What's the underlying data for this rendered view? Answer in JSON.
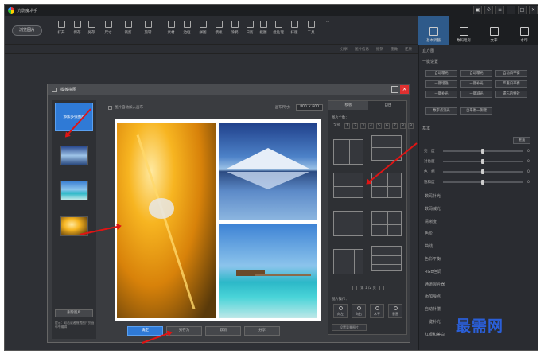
{
  "app": {
    "name": "光影魔术手"
  },
  "window_controls": [
    "▣",
    "ꖴ",
    "≡",
    "–",
    "□",
    "✕"
  ],
  "toolbar": {
    "open": "浏览图片",
    "tools": [
      "打开",
      "保存",
      "另存",
      "尺寸",
      "裁剪",
      "旋转",
      "素材",
      "边框",
      "拼图",
      "模板",
      "涂鸦",
      "日历",
      "抠图",
      "批处理",
      "排版",
      "工具",
      "···"
    ]
  },
  "right_tabs": [
    "基本调整",
    "数码暗房",
    "文字",
    "水印"
  ],
  "subbar": [
    "分享",
    "图片信息",
    "撤销",
    "重做",
    "还原"
  ],
  "right_panel": {
    "histogram": "直方图",
    "one_click": "一键设置",
    "buttons": [
      "自动曝光",
      "自动曝光",
      "自动白平衡",
      "一键增艳",
      "一键补光",
      "严重白平衡",
      "一键补光",
      "一键减光",
      "遗忘的特效",
      "数字点测光",
      "自平衡一侧键"
    ],
    "basic": "基本",
    "reset": "重置",
    "sliders": [
      {
        "label": "亮　度",
        "value": "0",
        "pos": 0.5
      },
      {
        "label": "对比度",
        "value": "0",
        "pos": 0.5
      },
      {
        "label": "色　相",
        "value": "0",
        "pos": 0.5
      },
      {
        "label": "饱和度",
        "value": "0",
        "pos": 0.5
      }
    ],
    "sections": [
      "数码补光",
      "数码减光",
      "清晰度",
      "色阶",
      "曲线",
      "色彩平衡",
      "RGB色调",
      "通道混合器",
      "添加噪点",
      "自动补偿",
      "一键补光",
      "红眼和美白"
    ]
  },
  "dialog": {
    "title": "模板拼图",
    "add_multi": "添加多张图片",
    "auto_add": "图片自动加入画布",
    "size_label": "画布尺寸：",
    "size_value": "800 × 600",
    "delete": "删除图片",
    "tip": "提示：双击或者拖拽图片到画布中编辑",
    "tabs": [
      "模板",
      "自由"
    ],
    "pic_count": "图片个数：",
    "counts": [
      "全部",
      "1",
      "2",
      "3",
      "4",
      "5",
      "6",
      "7",
      "8",
      "9"
    ],
    "pager": "第 1 /2 页",
    "ops": "图片操作：",
    "op_buttons": [
      "向左",
      "向右",
      "水平",
      "垂直"
    ],
    "set_bg": "设置背景图片",
    "footer": [
      "确定",
      "另存为",
      "取消",
      "分享"
    ]
  },
  "watermark": "最需网"
}
